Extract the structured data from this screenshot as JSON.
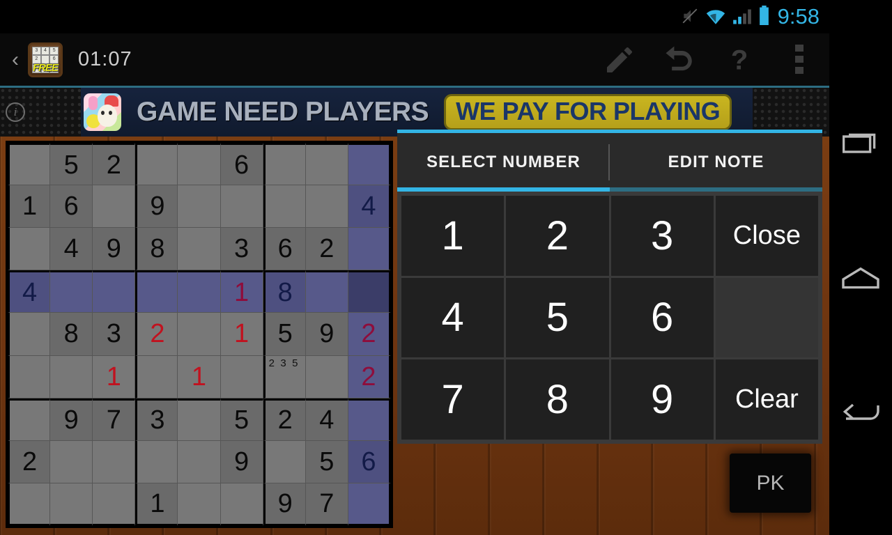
{
  "status_bar": {
    "time": "9:58",
    "icons": [
      "mute-icon",
      "wifi-icon",
      "signal-icon",
      "battery-icon"
    ],
    "accent_color": "#33b5e5"
  },
  "action_bar": {
    "back_glyph": "‹",
    "app_icon_label": "FREE",
    "timer": "01:07",
    "icons": [
      "pencil-icon",
      "undo-icon",
      "help-icon",
      "overflow-menu-icon"
    ]
  },
  "ad_banner": {
    "info_glyph": "i",
    "headline": "GAME NEED PLAYERS",
    "badge": "WE PAY FOR PLAYING"
  },
  "number_panel": {
    "tabs": [
      {
        "label": "SELECT NUMBER",
        "active": true
      },
      {
        "label": "EDIT NOTE",
        "active": false
      }
    ],
    "keys": [
      "1",
      "2",
      "3",
      "Close",
      "4",
      "5",
      "6",
      "",
      "7",
      "8",
      "9",
      "Clear"
    ]
  },
  "pk_button": {
    "label": "PK"
  },
  "nav_bar": {
    "buttons": [
      "recents-icon",
      "home-icon",
      "back-icon"
    ]
  },
  "board": {
    "selected": {
      "row": 3,
      "col": 8
    },
    "highlight_row": 3,
    "highlight_col": 8,
    "colors": {
      "cell_bg": "#787878",
      "given_bg": "#6a6a6a",
      "highlight_bg": "#57598a",
      "selected_bg": "#3b3d68",
      "user_value": "#c1121f",
      "given_value": "#0a0a0a"
    },
    "cells": [
      [
        {
          "v": "",
          "t": "e"
        },
        {
          "v": "5",
          "t": "g"
        },
        {
          "v": "2",
          "t": "g"
        },
        {
          "v": "",
          "t": "e"
        },
        {
          "v": "",
          "t": "e"
        },
        {
          "v": "6",
          "t": "g"
        },
        {
          "v": "",
          "t": "e"
        },
        {
          "v": "",
          "t": "e"
        },
        {
          "v": "",
          "t": "e"
        }
      ],
      [
        {
          "v": "1",
          "t": "g"
        },
        {
          "v": "6",
          "t": "g"
        },
        {
          "v": "",
          "t": "e"
        },
        {
          "v": "9",
          "t": "g"
        },
        {
          "v": "",
          "t": "e"
        },
        {
          "v": "",
          "t": "e"
        },
        {
          "v": "",
          "t": "e"
        },
        {
          "v": "",
          "t": "e"
        },
        {
          "v": "4",
          "t": "g"
        }
      ],
      [
        {
          "v": "",
          "t": "e"
        },
        {
          "v": "4",
          "t": "g"
        },
        {
          "v": "9",
          "t": "g"
        },
        {
          "v": "8",
          "t": "g"
        },
        {
          "v": "",
          "t": "e"
        },
        {
          "v": "3",
          "t": "g"
        },
        {
          "v": "6",
          "t": "g"
        },
        {
          "v": "2",
          "t": "g"
        },
        {
          "v": "",
          "t": "e"
        }
      ],
      [
        {
          "v": "4",
          "t": "g"
        },
        {
          "v": "",
          "t": "e"
        },
        {
          "v": "",
          "t": "e"
        },
        {
          "v": "",
          "t": "e"
        },
        {
          "v": "",
          "t": "e"
        },
        {
          "v": "1",
          "t": "u"
        },
        {
          "v": "8",
          "t": "g"
        },
        {
          "v": "",
          "t": "e"
        },
        {
          "v": "",
          "t": "e"
        }
      ],
      [
        {
          "v": "",
          "t": "e"
        },
        {
          "v": "8",
          "t": "g"
        },
        {
          "v": "3",
          "t": "g"
        },
        {
          "v": "2",
          "t": "u"
        },
        {
          "v": "",
          "t": "e"
        },
        {
          "v": "1",
          "t": "u"
        },
        {
          "v": "5",
          "t": "g"
        },
        {
          "v": "9",
          "t": "g"
        },
        {
          "v": "2",
          "t": "u"
        }
      ],
      [
        {
          "v": "",
          "t": "e"
        },
        {
          "v": "",
          "t": "e"
        },
        {
          "v": "1",
          "t": "u"
        },
        {
          "v": "",
          "t": "e"
        },
        {
          "v": "1",
          "t": "u"
        },
        {
          "v": "",
          "t": "e"
        },
        {
          "v": "",
          "t": "n",
          "notes": [
            "2",
            "3",
            "5"
          ]
        },
        {
          "v": "",
          "t": "e"
        },
        {
          "v": "2",
          "t": "u"
        }
      ],
      [
        {
          "v": "",
          "t": "e"
        },
        {
          "v": "9",
          "t": "g"
        },
        {
          "v": "7",
          "t": "g"
        },
        {
          "v": "3",
          "t": "g"
        },
        {
          "v": "",
          "t": "e"
        },
        {
          "v": "5",
          "t": "g"
        },
        {
          "v": "2",
          "t": "g"
        },
        {
          "v": "4",
          "t": "g"
        },
        {
          "v": "",
          "t": "e"
        }
      ],
      [
        {
          "v": "2",
          "t": "g"
        },
        {
          "v": "",
          "t": "e"
        },
        {
          "v": "",
          "t": "e"
        },
        {
          "v": "",
          "t": "e"
        },
        {
          "v": "",
          "t": "e"
        },
        {
          "v": "9",
          "t": "g"
        },
        {
          "v": "",
          "t": "e"
        },
        {
          "v": "5",
          "t": "g"
        },
        {
          "v": "6",
          "t": "g"
        }
      ],
      [
        {
          "v": "",
          "t": "e"
        },
        {
          "v": "",
          "t": "e"
        },
        {
          "v": "",
          "t": "e"
        },
        {
          "v": "1",
          "t": "g"
        },
        {
          "v": "",
          "t": "e"
        },
        {
          "v": "",
          "t": "e"
        },
        {
          "v": "9",
          "t": "g"
        },
        {
          "v": "7",
          "t": "g"
        },
        {
          "v": "",
          "t": "e"
        }
      ]
    ]
  }
}
